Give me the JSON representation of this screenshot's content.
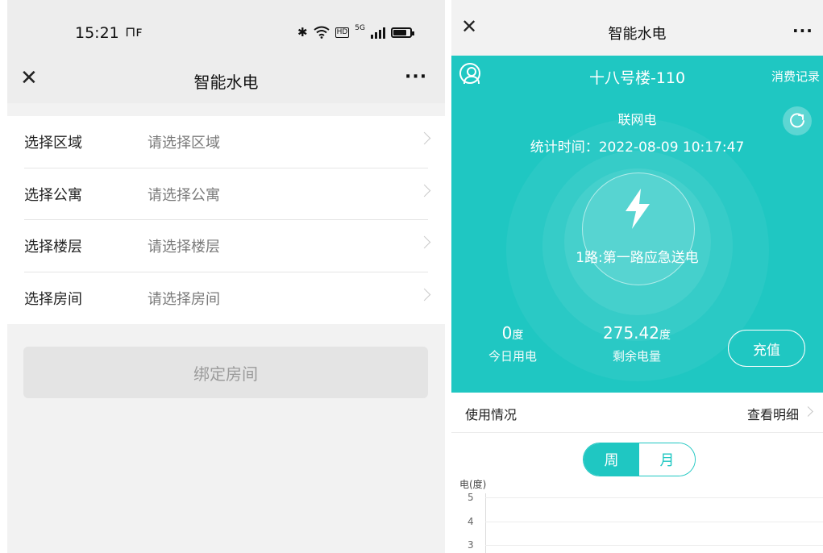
{
  "left": {
    "status_bar": {
      "time": "15:21",
      "carrier_glyph": "⟨⟩",
      "signal_label": "5G",
      "hd_label": "HD"
    },
    "nav": {
      "close": "✕",
      "title": "智能水电",
      "more": "···"
    },
    "rows": [
      {
        "label": "选择区域",
        "placeholder": "请选择区域"
      },
      {
        "label": "选择公寓",
        "placeholder": "请选择公寓"
      },
      {
        "label": "选择楼层",
        "placeholder": "请选择楼层"
      },
      {
        "label": "选择房间",
        "placeholder": "请选择房间"
      }
    ],
    "bind_button": "绑定房间"
  },
  "right": {
    "nav": {
      "close": "✕",
      "title": "智能水电",
      "more": "···"
    },
    "hero": {
      "room": "十八号楼-110",
      "records_link": "消费记录",
      "meter_type": "联网电",
      "stat_time": "统计时间：2022-08-09 10:17:47",
      "route": "1路:第一路应急送电",
      "today": {
        "value": "0",
        "unit": "度",
        "label": "今日用电"
      },
      "remaining": {
        "value": "275.42",
        "unit": "度",
        "label": "剩余电量"
      },
      "recharge": "充值",
      "accent_color": "#1fc7c2"
    },
    "usage": {
      "title": "使用情况",
      "detail_link": "查看明细"
    },
    "toggle": {
      "week": "周",
      "month": "月",
      "active": "周"
    },
    "chart": {
      "ylabel": "电(度)",
      "ticks": [
        "5",
        "4",
        "3"
      ]
    }
  }
}
